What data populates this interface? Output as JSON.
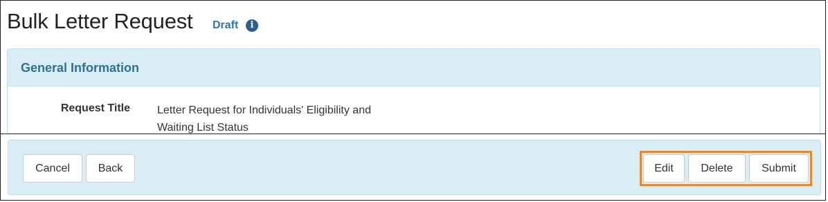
{
  "header": {
    "title": "Bulk Letter Request",
    "status": "Draft",
    "status_icon": "info-icon",
    "info_glyph": "i"
  },
  "general_info": {
    "heading": "General Information",
    "fields": [
      {
        "label": "Request Title",
        "value": "Letter Request for Individuals' Eligibility and Waiting List Status"
      }
    ]
  },
  "actions": {
    "left": [
      {
        "label": "Cancel"
      },
      {
        "label": "Back"
      }
    ],
    "right": [
      {
        "label": "Edit"
      },
      {
        "label": "Delete"
      },
      {
        "label": "Submit"
      }
    ]
  },
  "colors": {
    "accent": "#2f73b0",
    "panel_bg": "#d9edf7",
    "panel_heading_text": "#31708f",
    "highlight": "#e5892e"
  }
}
